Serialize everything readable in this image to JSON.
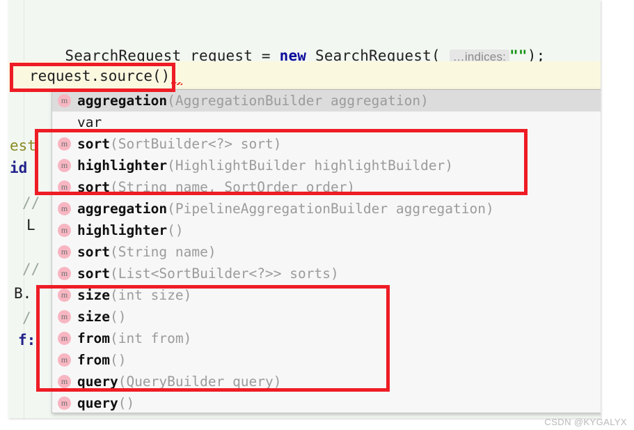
{
  "editor": {
    "line1": {
      "prefix": "SearchRequest request = ",
      "keyword": "new",
      "mid": " SearchRequest( ",
      "param_hint": "…indices:",
      "string_literal": "\"\"",
      "suffix": ");"
    },
    "caret_line": {
      "text": "request.source()",
      "dot": "."
    },
    "background_fragments": [
      {
        "text": "est",
        "kind": "type"
      },
      {
        "text": "id",
        "kind": "field"
      },
      {
        "text": "//",
        "kind": "comment"
      },
      {
        "text": "L",
        "kind": "plain"
      },
      {
        "text": "//",
        "kind": "comment"
      },
      {
        "text": "B.",
        "kind": "plain"
      },
      {
        "text": "/",
        "kind": "comment"
      },
      {
        "text": "f:",
        "kind": "field"
      }
    ]
  },
  "completion_popup": {
    "items": [
      {
        "icon": "m",
        "name": "aggregation",
        "signature": "(AggregationBuilder aggregation)",
        "selected": true
      },
      {
        "icon": "",
        "name": "var",
        "signature": "",
        "selected": false,
        "plain": true
      },
      {
        "icon": "m",
        "name": "sort",
        "signature": "(SortBuilder<?> sort)",
        "selected": false
      },
      {
        "icon": "m",
        "name": "highlighter",
        "signature": "(HighlightBuilder highlightBuilder)",
        "selected": false
      },
      {
        "icon": "m",
        "name": "sort",
        "signature": "(String name, SortOrder order)",
        "selected": false
      },
      {
        "icon": "m",
        "name": "aggregation",
        "signature": "(PipelineAggregationBuilder aggregation)",
        "selected": false
      },
      {
        "icon": "m",
        "name": "highlighter",
        "signature": "()",
        "selected": false
      },
      {
        "icon": "m",
        "name": "sort",
        "signature": "(String name)",
        "selected": false
      },
      {
        "icon": "m",
        "name": "sort",
        "signature": "(List<SortBuilder<?>> sorts)",
        "selected": false
      },
      {
        "icon": "m",
        "name": "size",
        "signature": "(int size)",
        "selected": false
      },
      {
        "icon": "m",
        "name": "size",
        "signature": "()",
        "selected": false
      },
      {
        "icon": "m",
        "name": "from",
        "signature": "(int from)",
        "selected": false
      },
      {
        "icon": "m",
        "name": "from",
        "signature": "()",
        "selected": false
      },
      {
        "icon": "m",
        "name": "query",
        "signature": "(QueryBuilder query)",
        "selected": false
      },
      {
        "icon": "m",
        "name": "query",
        "signature": "()",
        "selected": false
      }
    ]
  },
  "annotations": {
    "box_color": "#ee1c25",
    "boxes": [
      {
        "label": "highlight-caret-expression"
      },
      {
        "label": "highlight-sort-highlighter-group"
      },
      {
        "label": "highlight-size-from-query-group"
      }
    ]
  },
  "watermark": {
    "text": "CSDN @KYGALYX"
  },
  "colors": {
    "editor_bg": "#f2f7f1",
    "current_line_bg": "#fbf8e0",
    "popup_bg": "#f7f7f7",
    "selected_row_bg": "#dcdcdc",
    "keyword": "#0b0b9c",
    "string": "#149414",
    "signature_gray": "#9b9b9b",
    "method_icon_bg": "#f7b6c2",
    "annotation_red": "#ee1c25"
  }
}
